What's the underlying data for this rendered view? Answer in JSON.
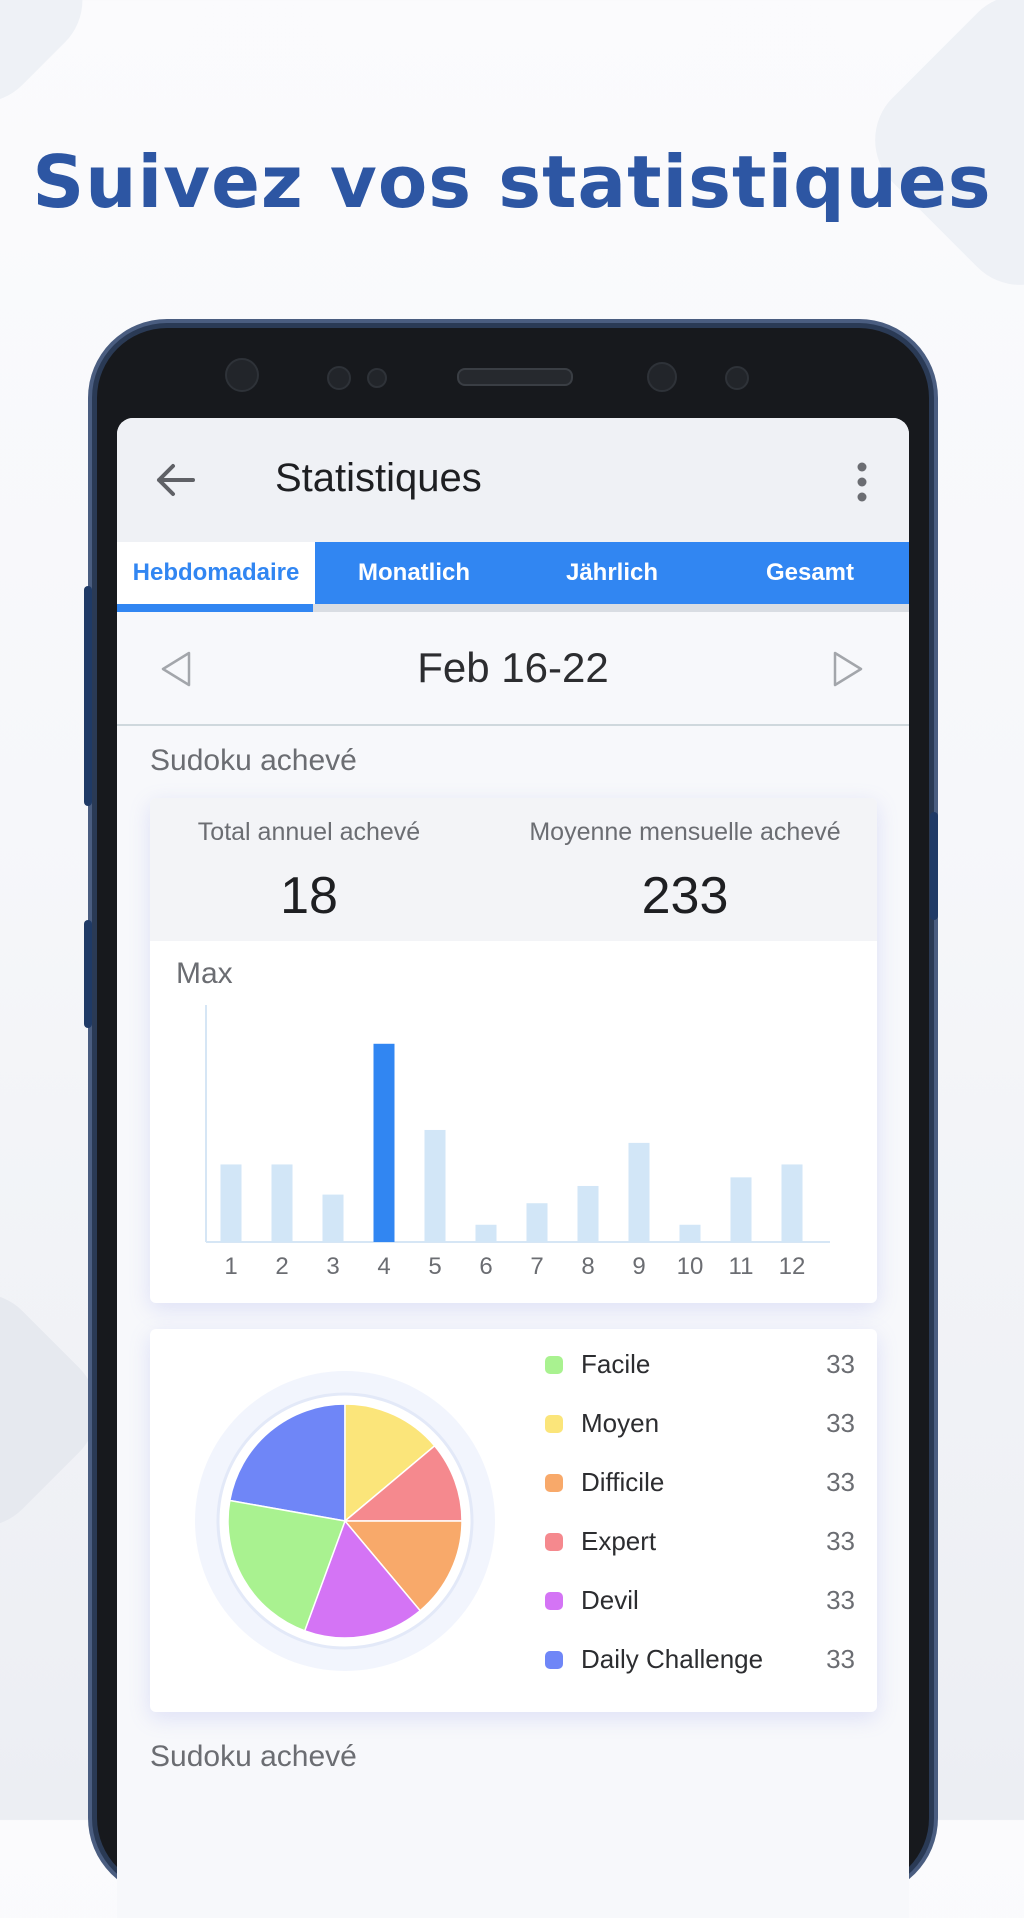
{
  "headline": "Suivez vos statistiques",
  "app": {
    "title": "Statistiques",
    "tabs": [
      "Hebdomadaire",
      "Monatlich",
      "Jährlich",
      "Gesamt"
    ],
    "active_tab": "Hebdomadaire",
    "date_range": "Feb 16-22",
    "section_title": "Sudoku achevé",
    "section_title_2": "Sudoku achevé",
    "stats": {
      "total_label": "Total annuel achevé",
      "total_value": "18",
      "average_label": "Moyenne mensuelle achevé",
      "average_value": "233"
    },
    "chart_label": "Max"
  },
  "colors": {
    "accent": "#3186f2",
    "bar": "#d2e6f7",
    "bar_highlight": "#3186f2",
    "headline": "#2d56a3"
  },
  "chart_data": [
    {
      "type": "bar",
      "categories": [
        "1",
        "2",
        "3",
        "4",
        "5",
        "6",
        "7",
        "8",
        "9",
        "10",
        "11",
        "12"
      ],
      "values": [
        18,
        18,
        11,
        46,
        26,
        4,
        9,
        13,
        23,
        4,
        15,
        18
      ],
      "highlight_index": 3,
      "ylim": [
        0,
        55
      ],
      "title": "",
      "xlabel": "",
      "ylabel": ""
    },
    {
      "type": "pie",
      "labels": [
        "Facile",
        "Moyen",
        "Difficile",
        "Expert",
        "Devil",
        "Daily Challenge"
      ],
      "values": [
        33,
        33,
        33,
        33,
        33,
        33
      ],
      "value_labels": [
        "33",
        "33",
        "33",
        "33",
        "33",
        "33"
      ],
      "colors": [
        "#a9f290",
        "#fbe57a",
        "#f8a96a",
        "#f5898e",
        "#d474f5",
        "#6f86f7"
      ],
      "display_slices": [
        {
          "label": "Daily Challenge",
          "share": 0.222
        },
        {
          "label": "Moyen",
          "share": 0.139
        },
        {
          "label": "Expert",
          "share": 0.111
        },
        {
          "label": "Difficile",
          "share": 0.139
        },
        {
          "label": "Devil",
          "share": 0.167
        },
        {
          "label": "Facile",
          "share": 0.222
        }
      ]
    }
  ]
}
